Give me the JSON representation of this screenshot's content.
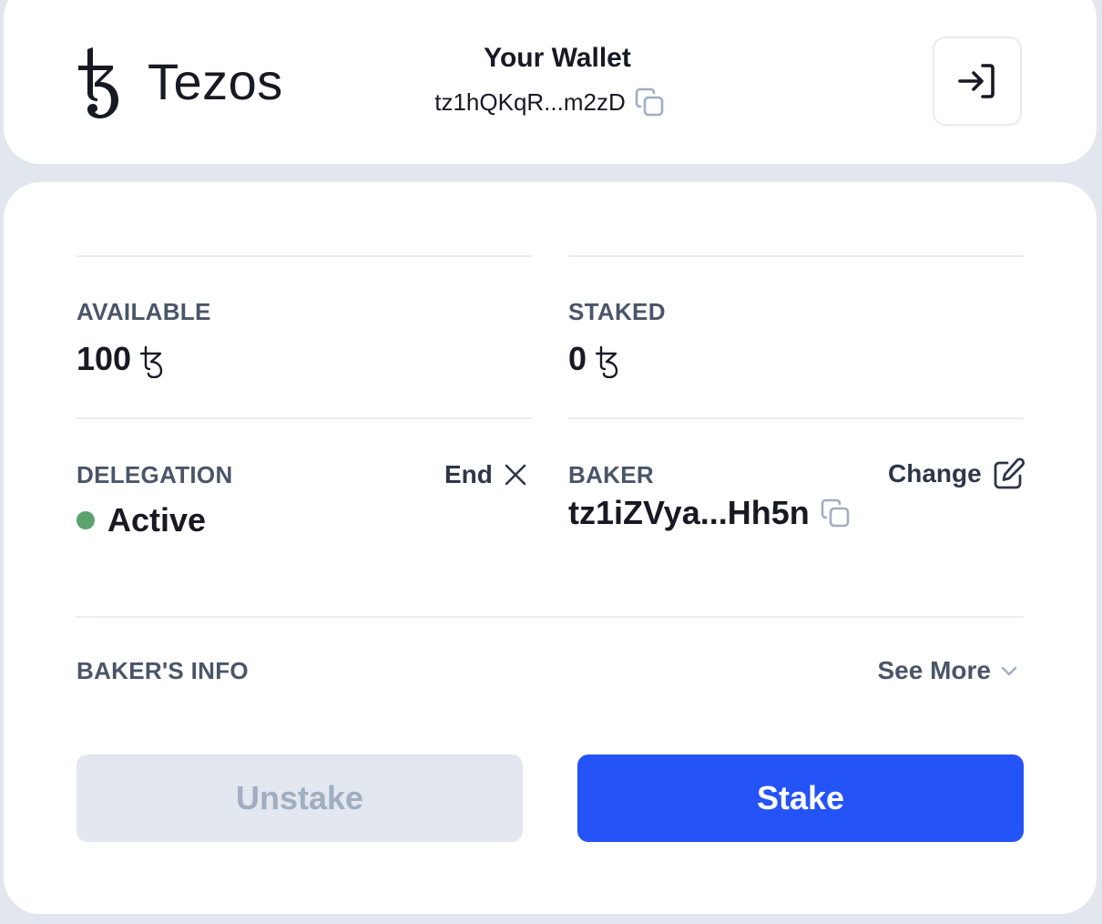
{
  "header": {
    "brand_name": "Tezos",
    "wallet_title": "Your Wallet",
    "wallet_address": "tz1hQKqR...m2zD",
    "copy_icon": "copy-icon",
    "logout_icon": "sign-in-arrow-icon"
  },
  "balances": {
    "available": {
      "label": "AVAILABLE",
      "amount": "100",
      "currency_icon": "tez-icon"
    },
    "staked": {
      "label": "STAKED",
      "amount": "0",
      "currency_icon": "tez-icon"
    }
  },
  "delegation": {
    "label": "DELEGATION",
    "end_label": "End",
    "status": "Active",
    "status_color": "#5ba26f"
  },
  "baker": {
    "label": "BAKER",
    "change_label": "Change",
    "address": "tz1iZVya...Hh5n"
  },
  "baker_info": {
    "label": "BAKER'S INFO",
    "see_more_label": "See More"
  },
  "actions": {
    "unstake_label": "Unstake",
    "stake_label": "Stake",
    "stake_color": "#2453f7"
  }
}
